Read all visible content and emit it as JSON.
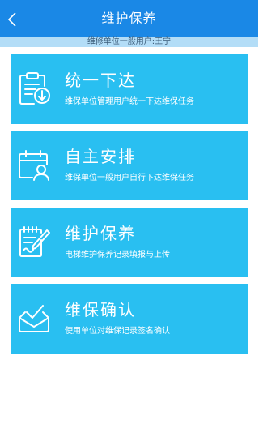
{
  "header": {
    "title": "维护保养",
    "back_icon": "chevron-left-icon"
  },
  "subbar": {
    "text": "维修单位一般用户:王宁"
  },
  "menu": [
    {
      "title": "统一下达",
      "desc": "维保单位管理用户统一下达维保任务",
      "icon": "clipboard-download-icon"
    },
    {
      "title": "自主安排",
      "desc": "维保单位一般用户自行下达维保任务",
      "icon": "calendar-user-icon"
    },
    {
      "title": "维护保养",
      "desc": "电梯维护保养记录填报与上传",
      "icon": "notepad-pencil-icon"
    },
    {
      "title": "维保确认",
      "desc": "使用单位对维保记录签名确认",
      "icon": "inbox-check-icon"
    }
  ],
  "colors": {
    "header_bg": "#1a88e6",
    "subbar_bg": "#b3ddf7",
    "card_bg": "#29bff1",
    "text_on_card": "#ffffff"
  }
}
